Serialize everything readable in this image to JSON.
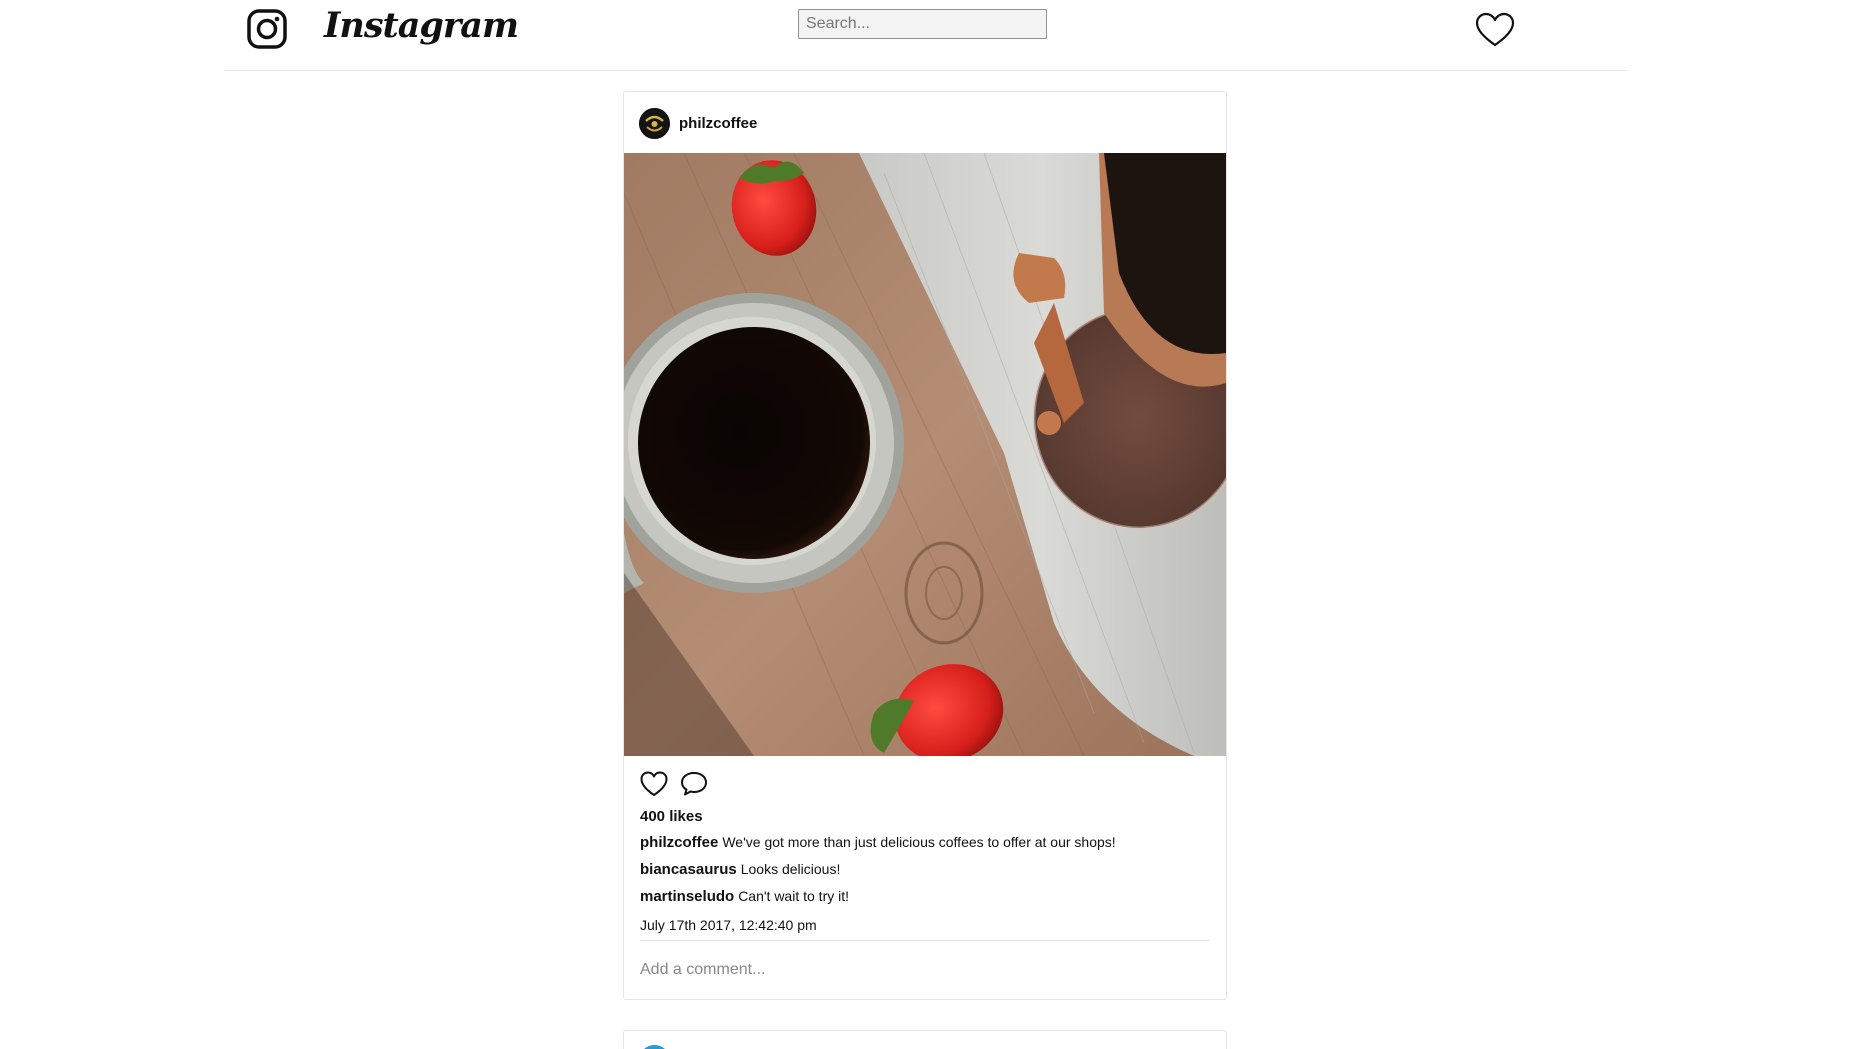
{
  "app": {
    "wordmark": "Instagram"
  },
  "search": {
    "placeholder": "Search..."
  },
  "post": {
    "username": "philzcoffee",
    "likes": "400 likes",
    "comments": [
      {
        "user": "philzcoffee",
        "text": "We've got more than just delicious coffees to offer at our shops!"
      },
      {
        "user": "biancasaurus",
        "text": "Looks delicious!"
      },
      {
        "user": "martinseludo",
        "text": "Can't wait to try it!"
      }
    ],
    "timestamp": "July 17th 2017, 12:42:40 pm",
    "add_comment_placeholder": "Add a comment..."
  },
  "icons": {
    "camera": "instagram-camera-icon",
    "activity": "heart-outline-icon",
    "like": "heart-outline-icon",
    "comment": "speech-bubble-icon"
  },
  "colors": {
    "border": "#e6e6e6",
    "text": "#111111",
    "search_bg": "#f3f3f3",
    "next_avatar": "#2a9ad6"
  }
}
